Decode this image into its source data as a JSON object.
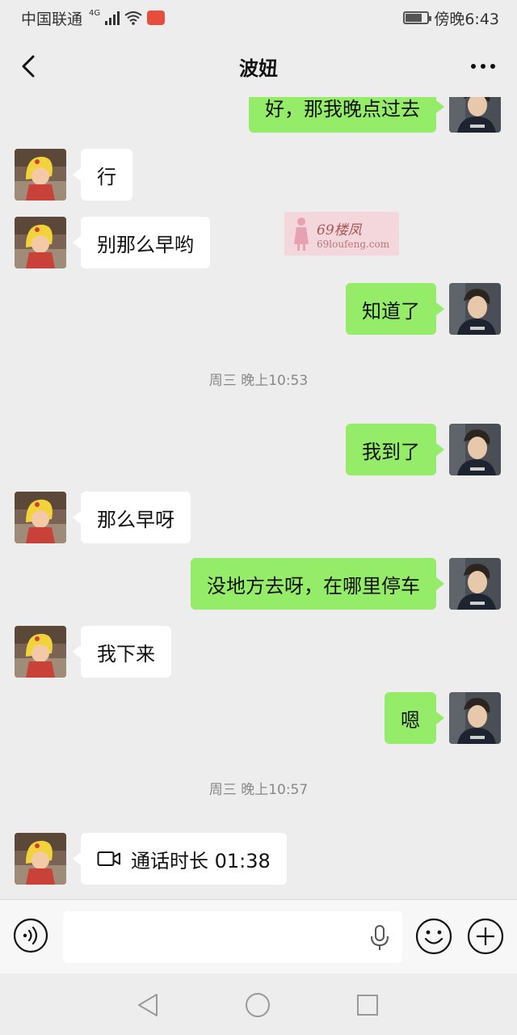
{
  "status_bar": {
    "carrier": "中国联通",
    "network": "4G",
    "time": "傍晚6:43",
    "battery_level": 0.75
  },
  "header": {
    "title": "波妞",
    "back_icon": "chevron-left-icon",
    "more_icon": "more-dots-icon"
  },
  "messages": [
    {
      "side": "right",
      "text": "好，那我晚点过去"
    },
    {
      "side": "left",
      "text": "行"
    },
    {
      "side": "left",
      "text": "别那么早哟"
    },
    {
      "side": "right",
      "text": "知道了"
    },
    {
      "type": "time",
      "text": "周三 晚上10:53"
    },
    {
      "side": "right",
      "text": "我到了"
    },
    {
      "side": "left",
      "text": "那么早呀"
    },
    {
      "side": "right",
      "text": "没地方去呀，在哪里停车"
    },
    {
      "side": "left",
      "text": "我下来"
    },
    {
      "side": "right",
      "text": "嗯"
    },
    {
      "type": "time",
      "text": "周三 晚上10:57"
    },
    {
      "side": "left",
      "type": "call",
      "text": "通话时长 01:38",
      "icon": "video-call-icon"
    }
  ],
  "watermark": {
    "title": "69楼凤",
    "url": "69loufeng.com"
  },
  "input_bar": {
    "placeholder": "",
    "voice_icon": "voice-icon",
    "mic_icon": "microphone-icon",
    "emoji_icon": "emoji-icon",
    "plus_icon": "plus-icon"
  },
  "colors": {
    "sent_bubble": "#95ec69",
    "received_bubble": "#ffffff",
    "background": "#ededed"
  }
}
